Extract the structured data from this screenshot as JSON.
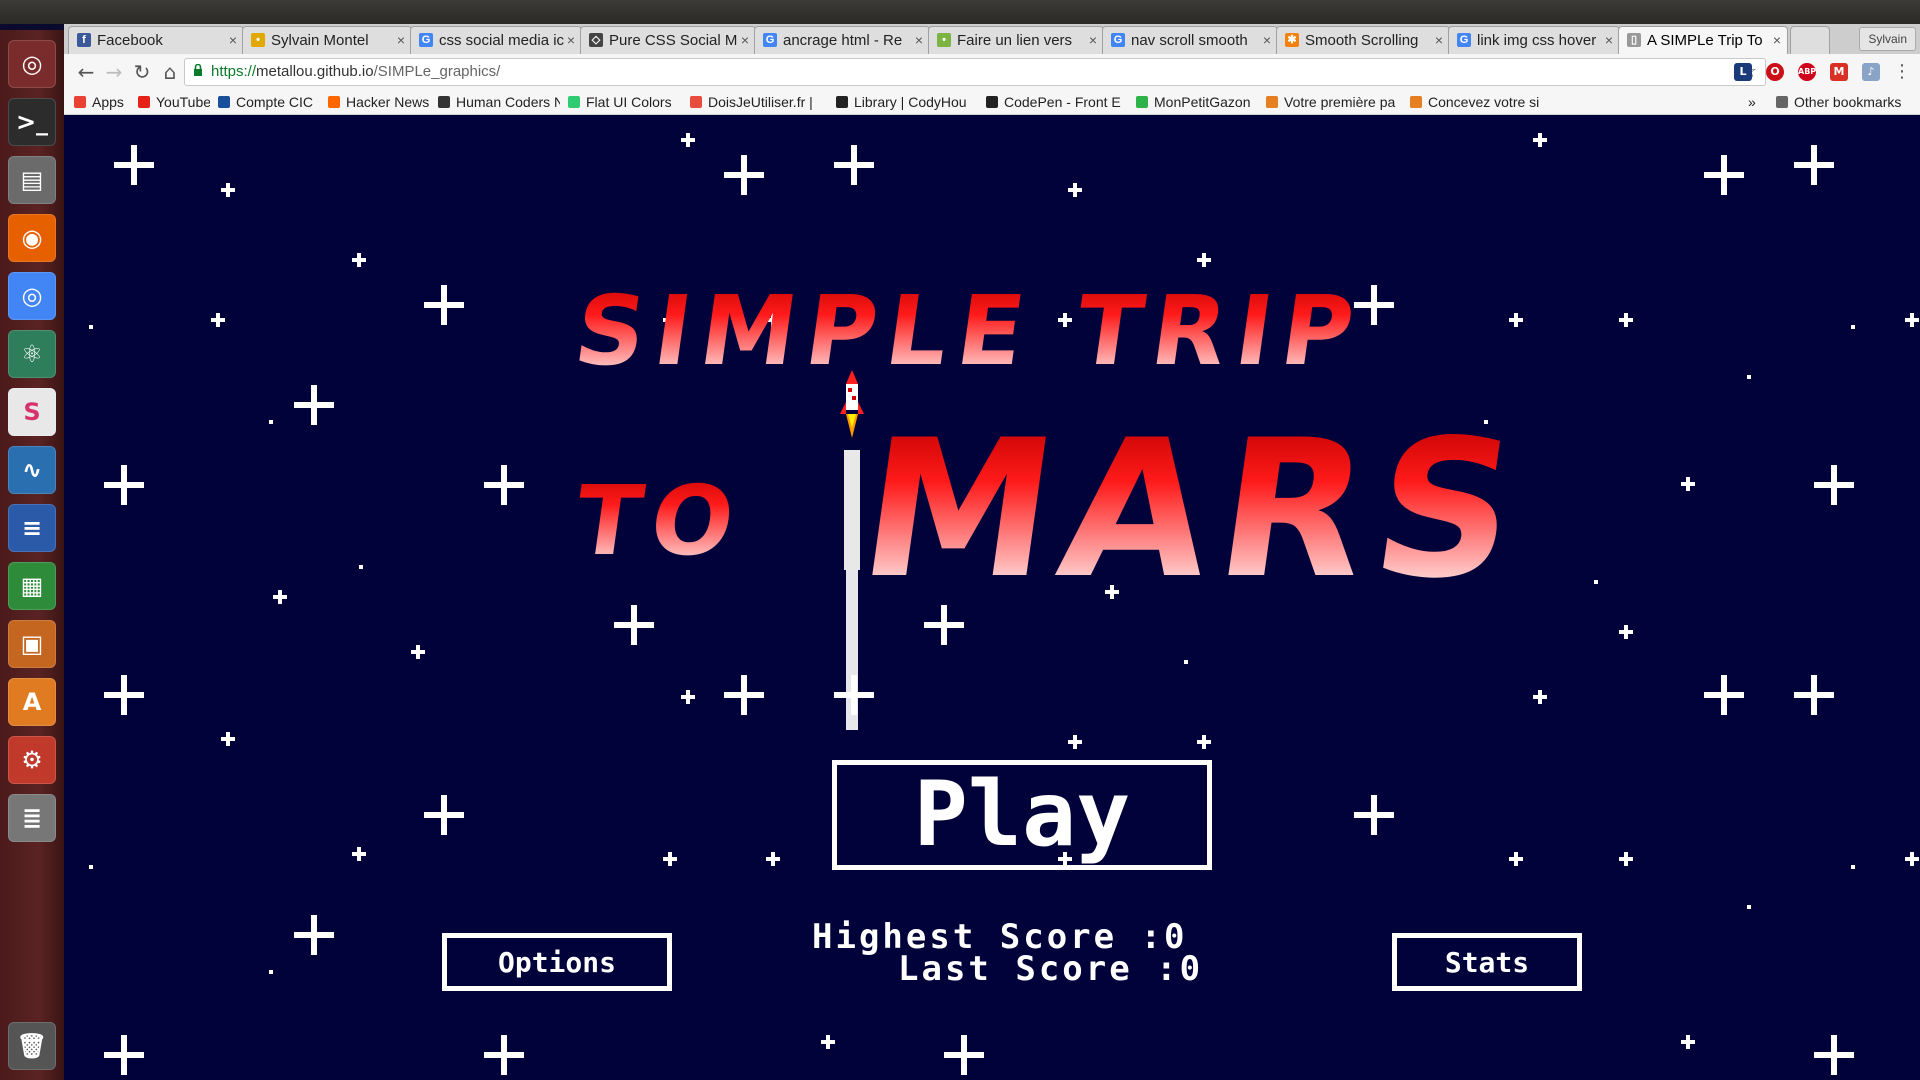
{
  "browser": {
    "tabs": [
      {
        "title": "Facebook",
        "favicon_color": "#3b5998",
        "favicon_glyph": "f"
      },
      {
        "title": "Sylvain Montel",
        "favicon_color": "#e0a800",
        "favicon_glyph": "•"
      },
      {
        "title": "css social media ic",
        "favicon_color": "#4285f4",
        "favicon_glyph": "G"
      },
      {
        "title": "Pure CSS Social M",
        "favicon_color": "#444444",
        "favicon_glyph": "◇"
      },
      {
        "title": "ancrage html - Re",
        "favicon_color": "#4285f4",
        "favicon_glyph": "G"
      },
      {
        "title": "Faire un lien vers",
        "favicon_color": "#7cb342",
        "favicon_glyph": "•"
      },
      {
        "title": "nav scroll smooth",
        "favicon_color": "#4285f4",
        "favicon_glyph": "G"
      },
      {
        "title": "Smooth Scrolling",
        "favicon_color": "#f4800b",
        "favicon_glyph": "✱"
      },
      {
        "title": "link img css hover",
        "favicon_color": "#4285f4",
        "favicon_glyph": "G"
      },
      {
        "title": "A SIMPLe Trip To",
        "favicon_color": "#999999",
        "favicon_glyph": "▯"
      }
    ],
    "user_name": "Sylvain",
    "url_scheme": "https://",
    "url_host": "metallou.github.io",
    "url_path": "/SIMPLe_graphics/",
    "bookmarks": [
      {
        "label": "Apps",
        "color": "#e94235"
      },
      {
        "label": "YouTube",
        "color": "#e62117"
      },
      {
        "label": "Compte CIC",
        "color": "#1a4f9c"
      },
      {
        "label": "Hacker News",
        "color": "#ff6600"
      },
      {
        "label": "Human Coders Ne",
        "color": "#333333"
      },
      {
        "label": "Flat UI Colors",
        "color": "#2ecc71"
      },
      {
        "label": "DoisJeUtiliser.fr |",
        "color": "#e74c3c"
      },
      {
        "label": "Library | CodyHou",
        "color": "#222222"
      },
      {
        "label": "CodePen - Front E",
        "color": "#222222"
      },
      {
        "label": "MonPetitGazon",
        "color": "#2db34a"
      },
      {
        "label": "Votre première pa",
        "color": "#e67e22"
      },
      {
        "label": "Concevez votre si",
        "color": "#e67e22"
      }
    ],
    "bookmarks_overflow": "»",
    "other_bookmarks": "Other bookmarks"
  },
  "game": {
    "title_line1": "SIMPLE TRIP",
    "title_line2a": "TO",
    "title_line2b": "MARS",
    "play_label": "Play",
    "options_label": "Options",
    "stats_label": "Stats",
    "highest_score_label": "Highest Score :",
    "highest_score_value": "0",
    "last_score_label": "Last Score :",
    "last_score_value": "0",
    "background_color": "#02023a",
    "title_color": "#ff1a1a"
  },
  "launcher": [
    {
      "icon": "ubuntu-dash-icon"
    },
    {
      "icon": "terminal-icon"
    },
    {
      "icon": "files-icon"
    },
    {
      "icon": "firefox-icon"
    },
    {
      "icon": "chrome-icon"
    },
    {
      "icon": "atom-icon"
    },
    {
      "icon": "slack-icon"
    },
    {
      "icon": "system-monitor-icon"
    },
    {
      "icon": "writer-icon"
    },
    {
      "icon": "calc-icon"
    },
    {
      "icon": "impress-icon"
    },
    {
      "icon": "software-center-icon"
    },
    {
      "icon": "settings-icon"
    },
    {
      "icon": "mixer-icon"
    },
    {
      "icon": "trash-icon"
    }
  ]
}
